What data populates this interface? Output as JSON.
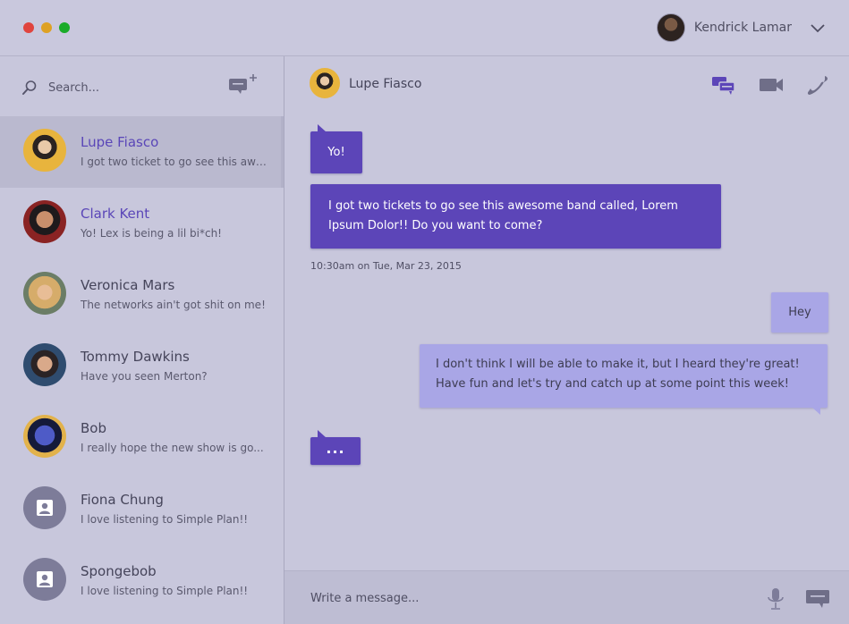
{
  "window": {
    "controls": [
      "close",
      "minimize",
      "maximize"
    ],
    "colors": {
      "close": "#e0443e",
      "minimize": "#dea123",
      "maximize": "#1aab29"
    }
  },
  "user": {
    "name": "Kendrick Lamar",
    "menu_icon": "chevron-down-icon"
  },
  "sidebar": {
    "search_placeholder": "Search...",
    "new_chat_icon": "new-message-icon",
    "contacts": [
      {
        "name": "Lupe Fiasco",
        "preview": "I got two ticket to go see this awe...",
        "active": true,
        "highlight": true
      },
      {
        "name": "Clark Kent",
        "preview": "Yo! Lex is being a lil bi*ch!",
        "active": false,
        "highlight": true
      },
      {
        "name": "Veronica Mars",
        "preview": "The networks ain't got shit on me!",
        "active": false,
        "highlight": false
      },
      {
        "name": "Tommy Dawkins",
        "preview": "Have you seen Merton?",
        "active": false,
        "highlight": false
      },
      {
        "name": "Bob",
        "preview": "I really hope the new show is go...",
        "active": false,
        "highlight": false
      },
      {
        "name": "Fiona Chung",
        "preview": "I love listening to Simple Plan!!",
        "active": false,
        "highlight": false
      },
      {
        "name": "Spongebob",
        "preview": "I love listening to Simple Plan!!",
        "active": false,
        "highlight": false
      }
    ]
  },
  "chat": {
    "contact_name": "Lupe Fiasco",
    "header_icons": [
      "chat-icon",
      "video-camera-icon",
      "phone-icon"
    ],
    "messages": [
      {
        "from": "them",
        "text": "Yo!"
      },
      {
        "from": "them",
        "text": "I got two tickets to go see this awesome band called, Lorem Ipsum Dolor!! Do you want to come?"
      },
      {
        "from": "me",
        "text": "Hey"
      },
      {
        "from": "me",
        "text": "I don't think I will be able to make it, but I heard they're great! Have fun and let's try and catch up at some point this week!"
      },
      {
        "from": "them",
        "text": "..."
      }
    ],
    "timestamp": "10:30am on Tue, Mar 23, 2015",
    "composer_placeholder": "Write a message...",
    "colors": {
      "incoming": "#5c45b8",
      "outgoing": "#a9a6e6",
      "accent": "#5a46b8"
    }
  }
}
